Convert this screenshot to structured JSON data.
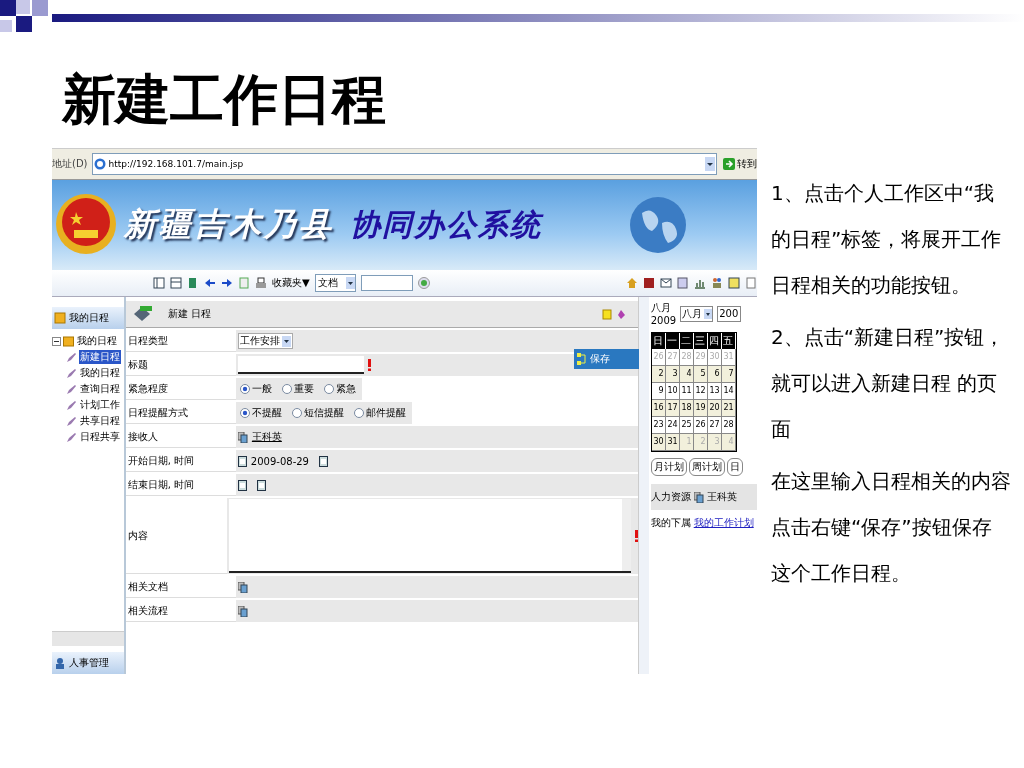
{
  "slide": {
    "title": "新建工作日程"
  },
  "browser": {
    "address_label": "地址(D)",
    "url": "http://192.168.101.7/main.jsp",
    "go_label": "转到"
  },
  "banner": {
    "county": "新疆吉木乃县",
    "system": "协同办公系统"
  },
  "toolbar": {
    "favorites": "收藏夹▼",
    "search_scope": "文档"
  },
  "sidebar": {
    "header": "我的日程",
    "tree": [
      {
        "label": "我的日程",
        "expanded": true,
        "children": [
          {
            "label": "新建日程",
            "selected": true
          },
          {
            "label": "我的日程",
            "selected": false
          },
          {
            "label": "查询日程",
            "selected": false
          },
          {
            "label": "计划工作",
            "selected": false
          },
          {
            "label": "共享日程",
            "selected": false
          },
          {
            "label": "日程共享",
            "selected": false
          }
        ]
      }
    ],
    "footer": "人事管理"
  },
  "form": {
    "title": "新建 日程",
    "rows": [
      {
        "kind": "select",
        "label": "日程类型",
        "value": "工作安排"
      },
      {
        "kind": "text",
        "label": "标题",
        "required": true
      },
      {
        "kind": "radio",
        "label": "紧急程度",
        "options": [
          {
            "label": "一般",
            "selected": true
          },
          {
            "label": "重要",
            "selected": false
          },
          {
            "label": "紧急",
            "selected": false
          }
        ]
      },
      {
        "kind": "radio",
        "label": "日程提醒方式",
        "options": [
          {
            "label": "不提醒",
            "selected": true
          },
          {
            "label": "短信提醒",
            "selected": false
          },
          {
            "label": "邮件提醒",
            "selected": false
          }
        ]
      },
      {
        "kind": "person",
        "label": "接收人",
        "value": "王科英"
      },
      {
        "kind": "datetime",
        "label": "开始日期, 时间",
        "value": "2009-08-29"
      },
      {
        "kind": "datetime",
        "label": "结束日期, 时间"
      },
      {
        "kind": "textarea",
        "label": "内容",
        "required": true
      },
      {
        "kind": "attach",
        "label": "相关文档"
      },
      {
        "kind": "attach",
        "label": "相关流程"
      }
    ]
  },
  "context_menu": {
    "items": [
      {
        "label": "保存",
        "selected": true
      }
    ]
  },
  "calendar": {
    "caption_month": "八月",
    "caption_year": "2009",
    "month_select": "八月",
    "year_select": "200",
    "weekdays": [
      "日",
      "一",
      "二",
      "三",
      "四",
      "五"
    ],
    "weeks": [
      [
        {
          "day": "26",
          "other": true
        },
        {
          "day": "27",
          "other": true
        },
        {
          "day": "28",
          "other": true
        },
        {
          "day": "29",
          "other": true
        },
        {
          "day": "30",
          "other": true
        },
        {
          "day": "31",
          "other": true
        }
      ],
      [
        {
          "day": "2",
          "other": false
        },
        {
          "day": "3",
          "other": false
        },
        {
          "day": "4",
          "other": false
        },
        {
          "day": "5",
          "other": false
        },
        {
          "day": "6",
          "other": false
        },
        {
          "day": "7",
          "other": false
        }
      ],
      [
        {
          "day": "9",
          "other": false
        },
        {
          "day": "10",
          "other": false
        },
        {
          "day": "11",
          "other": false
        },
        {
          "day": "12",
          "other": false
        },
        {
          "day": "13",
          "other": false
        },
        {
          "day": "14",
          "other": false
        }
      ],
      [
        {
          "day": "16",
          "other": false
        },
        {
          "day": "17",
          "other": false
        },
        {
          "day": "18",
          "other": false
        },
        {
          "day": "19",
          "other": false
        },
        {
          "day": "20",
          "other": false
        },
        {
          "day": "21",
          "other": false
        }
      ],
      [
        {
          "day": "23",
          "other": false
        },
        {
          "day": "24",
          "other": false
        },
        {
          "day": "25",
          "other": false
        },
        {
          "day": "26",
          "other": false
        },
        {
          "day": "27",
          "other": false
        },
        {
          "day": "28",
          "other": false
        }
      ],
      [
        {
          "day": "30",
          "other": false
        },
        {
          "day": "31",
          "other": false
        },
        {
          "day": "1",
          "other": true
        },
        {
          "day": "2",
          "other": true
        },
        {
          "day": "3",
          "other": true
        },
        {
          "day": "4",
          "other": true
        }
      ]
    ],
    "buttons": [
      "月计划",
      "周计划",
      "日"
    ],
    "hr_label": "人力资源",
    "hr_person": "王科英",
    "sub_label": "我的下属",
    "sub_link": "我的工作计划"
  },
  "notes": [
    "1、点击个人工作区中“我的日程”标签，将展开工作日程相关的功能按钮。",
    "2、点击“新建日程”按钮，就可以进入新建日程 的页面",
    "在这里输入日程相关的内容点击右键“保存”按钮保存这个工作日程。"
  ]
}
